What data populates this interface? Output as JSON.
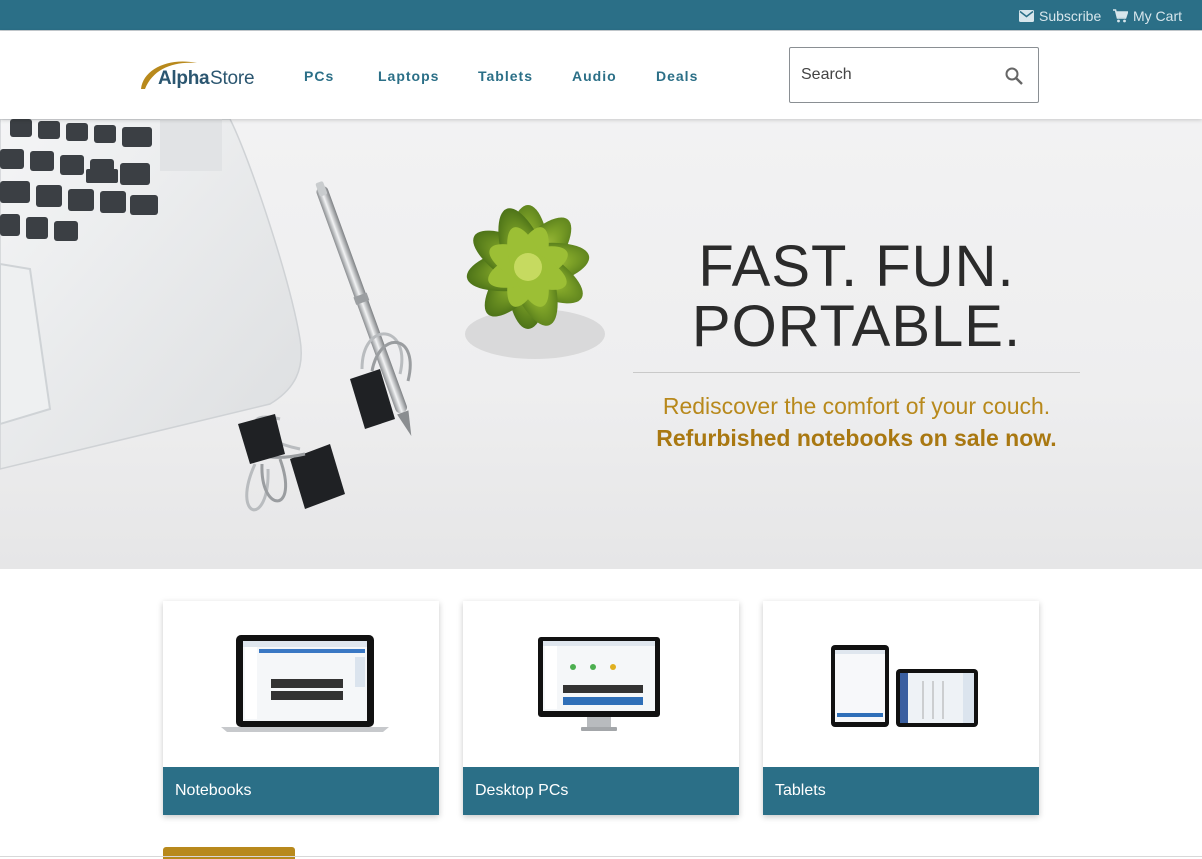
{
  "topbar": {
    "subscribe_label": "Subscribe",
    "cart_label": "My Cart"
  },
  "brand": {
    "logo_part1": "Alpha",
    "logo_part2": "Store"
  },
  "nav": {
    "items": [
      {
        "label": "PCs"
      },
      {
        "label": "Laptops"
      },
      {
        "label": "Tablets"
      },
      {
        "label": "Audio"
      },
      {
        "label": "Deals"
      }
    ]
  },
  "search": {
    "placeholder": "Search"
  },
  "hero": {
    "title_line1": "FAST. FUN.",
    "title_line2": "PORTABLE.",
    "subtitle_line1": "Rediscover the comfort of your couch.",
    "subtitle_line2": "Refurbished notebooks on sale now."
  },
  "categories": [
    {
      "label": "Notebooks"
    },
    {
      "label": "Desktop PCs"
    },
    {
      "label": "Tablets"
    }
  ],
  "colors": {
    "primary": "#2b6f87",
    "accent": "#b8891c",
    "hero_bg": "#eeeeef"
  }
}
